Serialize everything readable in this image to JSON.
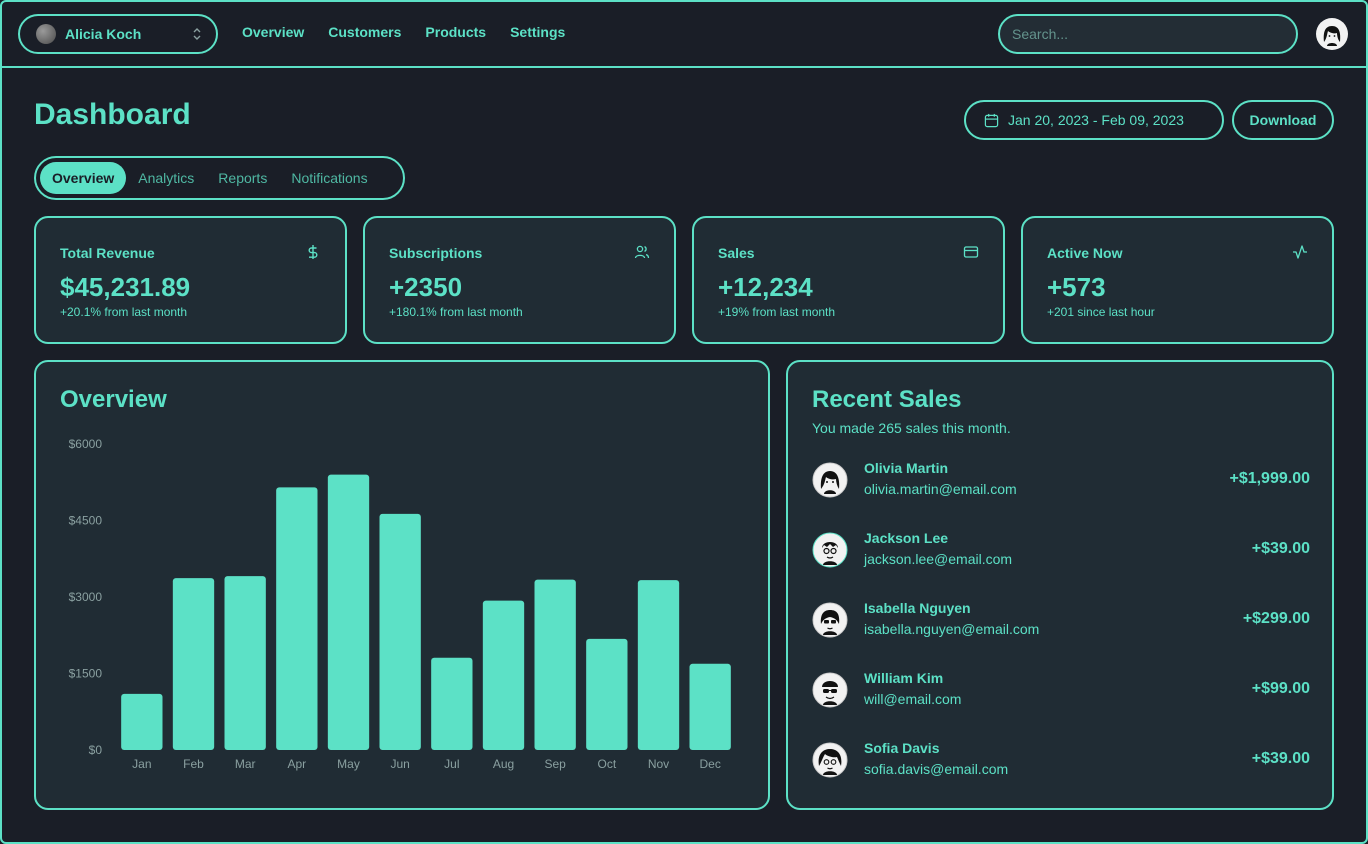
{
  "topbar": {
    "user_name": "Alicia Koch",
    "nav": [
      "Overview",
      "Customers",
      "Products",
      "Settings"
    ],
    "search_placeholder": "Search..."
  },
  "header": {
    "title": "Dashboard",
    "date_range": "Jan 20, 2023 - Feb 09, 2023",
    "download_label": "Download"
  },
  "tabs": [
    {
      "label": "Overview",
      "active": true
    },
    {
      "label": "Analytics",
      "active": false
    },
    {
      "label": "Reports",
      "active": false
    },
    {
      "label": "Notifications",
      "active": false
    }
  ],
  "stats": [
    {
      "label": "Total Revenue",
      "value": "$45,231.89",
      "sub": "+20.1% from last month",
      "icon": "dollar-icon"
    },
    {
      "label": "Subscriptions",
      "value": "+2350",
      "sub": "+180.1% from last month",
      "icon": "users-icon"
    },
    {
      "label": "Sales",
      "value": "+12,234",
      "sub": "+19% from last month",
      "icon": "credit-card-icon"
    },
    {
      "label": "Active Now",
      "value": "+573",
      "sub": "+201 since last hour",
      "icon": "activity-icon"
    }
  ],
  "overview": {
    "title": "Overview"
  },
  "chart_data": {
    "type": "bar",
    "title": "Overview",
    "categories": [
      "Jan",
      "Feb",
      "Mar",
      "Apr",
      "May",
      "Jun",
      "Jul",
      "Aug",
      "Sep",
      "Oct",
      "Nov",
      "Dec"
    ],
    "values": [
      1100,
      3370,
      3410,
      5150,
      5400,
      4630,
      1810,
      2930,
      3340,
      2180,
      3330,
      1690
    ],
    "ylim": [
      0,
      6000
    ],
    "yticks": [
      "$0",
      "$1500",
      "$3000",
      "$4500",
      "$6000"
    ],
    "ytick_values": [
      0,
      1500,
      3000,
      4500,
      6000
    ],
    "grid": false,
    "xlabel": "",
    "ylabel": ""
  },
  "recent_sales": {
    "title": "Recent Sales",
    "subtitle": "You made 265 sales this month.",
    "items": [
      {
        "name": "Olivia Martin",
        "email": "olivia.martin@email.com",
        "amount": "+$1,999.00"
      },
      {
        "name": "Jackson Lee",
        "email": "jackson.lee@email.com",
        "amount": "+$39.00"
      },
      {
        "name": "Isabella Nguyen",
        "email": "isabella.nguyen@email.com",
        "amount": "+$299.00"
      },
      {
        "name": "William Kim",
        "email": "will@email.com",
        "amount": "+$99.00"
      },
      {
        "name": "Sofia Davis",
        "email": "sofia.davis@email.com",
        "amount": "+$39.00"
      }
    ]
  },
  "colors": {
    "accent": "#5ce1c6",
    "background": "#1a1e27",
    "card": "#202c34"
  }
}
